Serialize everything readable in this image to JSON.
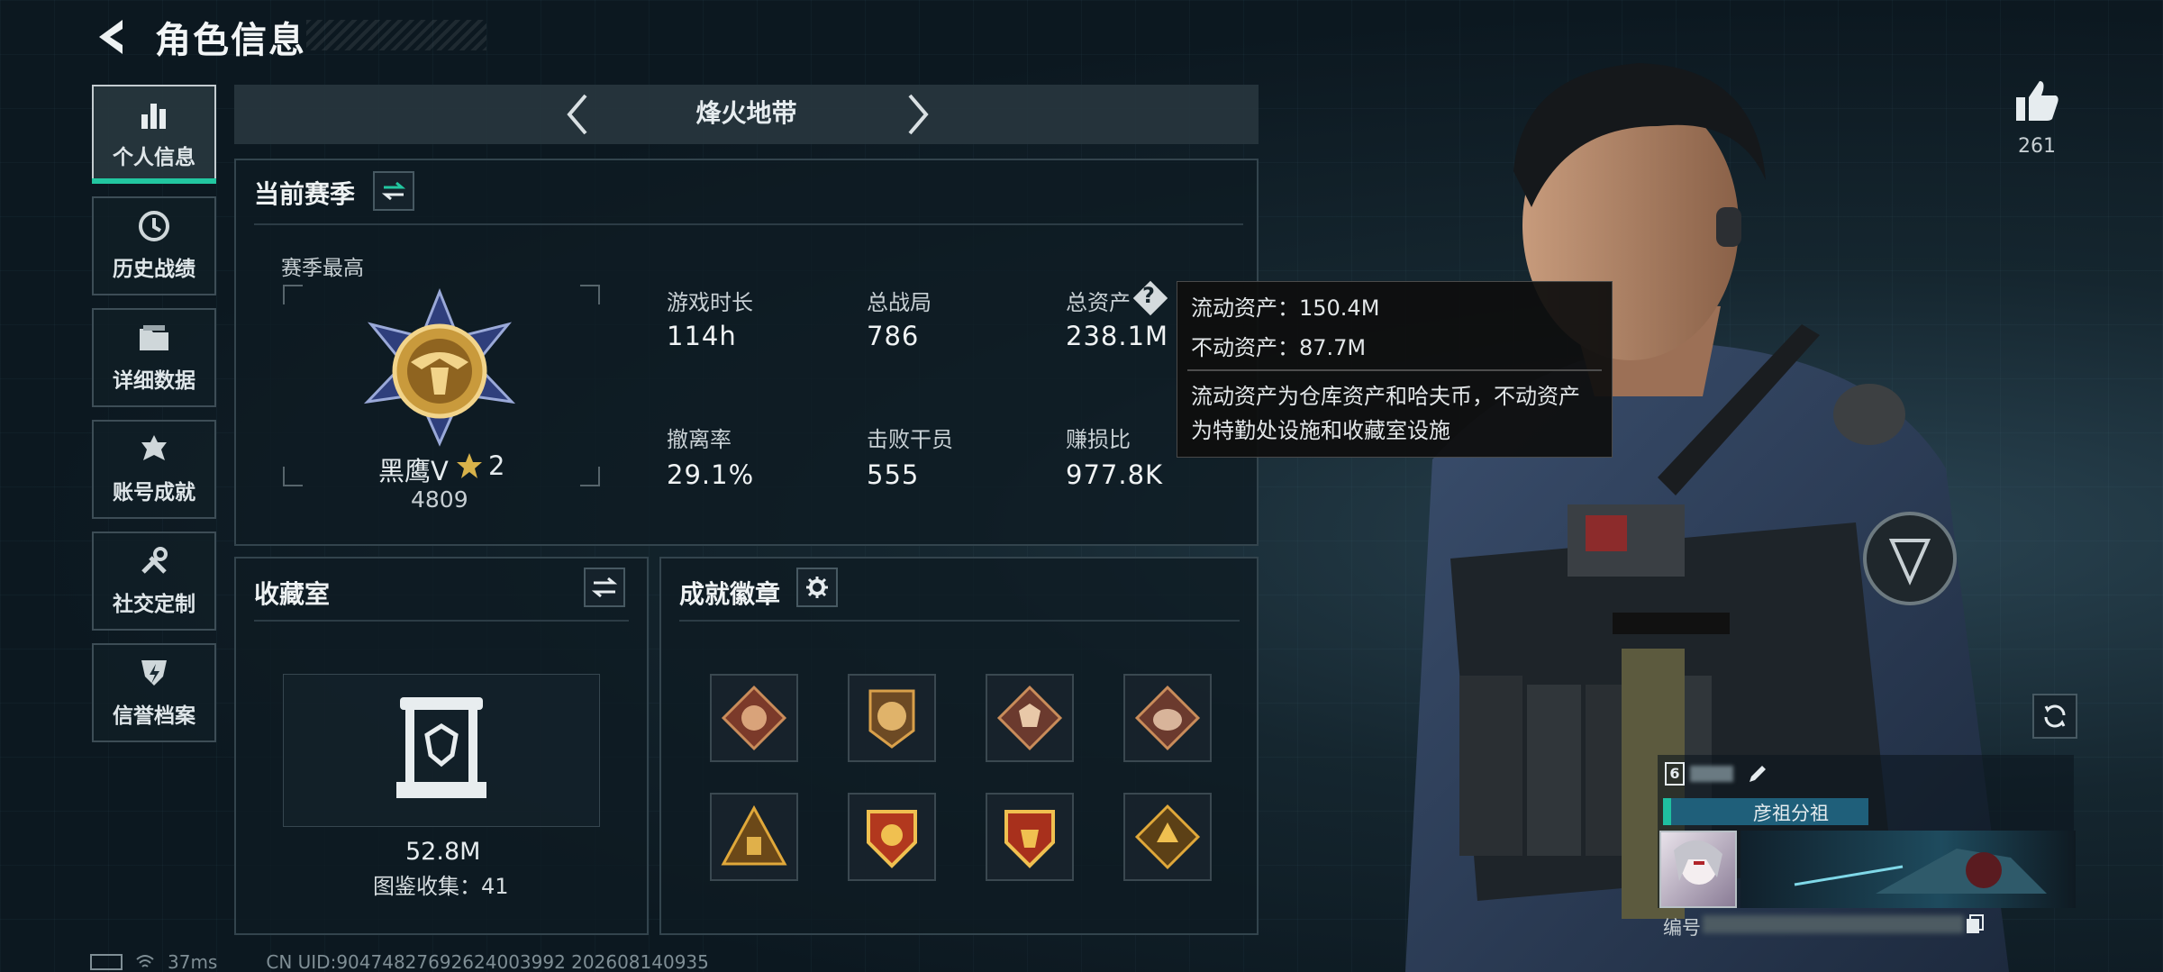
{
  "header": {
    "title": "角色信息"
  },
  "sidebar": {
    "items": [
      {
        "label": "个人信息",
        "icon": "bar-chart-icon",
        "active": true
      },
      {
        "label": "历史战绩",
        "icon": "history-icon",
        "active": false
      },
      {
        "label": "详细数据",
        "icon": "folder-icon",
        "active": false
      },
      {
        "label": "账号成就",
        "icon": "achievement-icon",
        "active": false
      },
      {
        "label": "社交定制",
        "icon": "wrench-icon",
        "active": false
      },
      {
        "label": "信誉档案",
        "icon": "reputation-icon",
        "active": false
      }
    ]
  },
  "mode": {
    "title": "烽火地带"
  },
  "season": {
    "title": "当前赛季",
    "best_label": "赛季最高",
    "rank_name": "黑鹰Ⅴ",
    "rank_stars": "2",
    "rank_points": "4809",
    "stats": [
      {
        "label": "游戏时长",
        "value": "114h"
      },
      {
        "label": "总战局",
        "value": "786"
      },
      {
        "label": "总资产",
        "value": "238.1M"
      },
      {
        "label": "撤离率",
        "value": "29.1%"
      },
      {
        "label": "击败干员",
        "value": "555"
      },
      {
        "label": "赚损比",
        "value": "977.8K"
      }
    ]
  },
  "tooltip": {
    "liquid": "流动资产：150.4M",
    "fixed": "不动资产：87.7M",
    "desc_line1": "流动资产为仓库资产和哈夫币，不动资产",
    "desc_line2": "为特勤处设施和收藏室设施"
  },
  "collection": {
    "title": "收藏室",
    "value": "52.8M",
    "collected": "图鉴收集：41"
  },
  "achievements": {
    "title": "成就徽章",
    "badges": [
      "dragon-badge-icon",
      "lion-badge-icon",
      "wolf-badge-icon",
      "boar-badge-icon",
      "triangle-badge-icon",
      "shield-badge-icon",
      "shield-badge-red-icon",
      "hex-badge-icon"
    ]
  },
  "likes": {
    "count": "261"
  },
  "player_card": {
    "level": "6",
    "team": "彦祖分祖",
    "id_label": "编号"
  },
  "status": {
    "ping": "37ms",
    "uid": "CN UID:904748276926240039​92 202608140935"
  },
  "colors": {
    "accent": "#22c6a0",
    "team_bar": "#1f5f7a"
  }
}
